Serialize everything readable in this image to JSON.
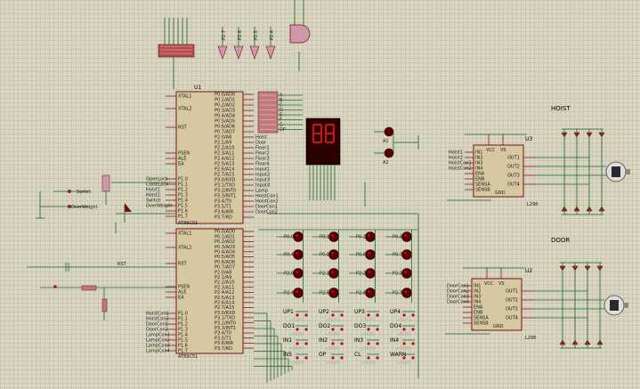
{
  "labels": {
    "u1": "U1",
    "u2": "U2",
    "u3": "U3",
    "hoist": "HOIST",
    "door": "DOOR",
    "mcu_top_part": "AT89C51",
    "mcu_bottom_part": "AT89C51",
    "driver_part": "L298",
    "switch_label": "Switch",
    "overweight_label": "OverWeight",
    "rst_label": "RST",
    "a1": "A1",
    "a2": "A2",
    "bit_label": "BIT",
    "text_placeholder": "<TEXT>"
  },
  "mcu_top_left_pins": [
    "XTAL1",
    "XTAL2",
    "RST",
    "PSEN",
    "ALE",
    "EA",
    "P1.0",
    "P1.1",
    "P1.2",
    "P1.3",
    "P1.4",
    "P1.5",
    "P1.6",
    "P1.7"
  ],
  "mcu_top_right_pins": [
    "P0.0/AD0",
    "P0.1/AD1",
    "P0.2/AD2",
    "P0.3/AD3",
    "P0.4/AD4",
    "P0.5/AD5",
    "P0.6/AD6",
    "P0.7/AD7",
    "P2.0/A8",
    "P2.1/A9",
    "P2.2/A10",
    "P2.3/A11",
    "P2.4/A12",
    "P2.5/A13",
    "P2.6/A14",
    "P2.7/A15",
    "P3.0/RXD",
    "P3.1/TXD",
    "P3.2/INT0",
    "P3.3/INT1",
    "P3.4/T0",
    "P3.5/T1",
    "P3.6/WR",
    "P3.7/RD"
  ],
  "mcu_bottom_left_pins": [
    "XTAL1",
    "XTAL2",
    "RST",
    "PSEN",
    "ALE",
    "EA",
    "P1.0",
    "P1.1",
    "P1.2",
    "P1.3",
    "P1.4",
    "P1.5",
    "P1.6",
    "P1.7"
  ],
  "mcu_bottom_right_pins": [
    "P0.0/AD0",
    "P0.1/AD1",
    "P0.2/AD2",
    "P0.3/AD3",
    "P0.4/AD4",
    "P0.5/AD5",
    "P0.6/AD6",
    "P0.7/AD7",
    "P2.0/A8",
    "P2.1/A9",
    "P2.2/A10",
    "P2.3/A11",
    "P2.4/A12",
    "P2.5/A13",
    "P2.6/A14",
    "P2.7/A15",
    "P3.0/RXD",
    "P3.1/TXD",
    "P3.2/INT0",
    "P3.3/INT1",
    "P3.4/T0",
    "P3.5/T1",
    "P3.6/WR",
    "P3.7/RD"
  ],
  "mcu_top_left_nets": [
    "OpenLock",
    "CloseLock",
    "Hoist1",
    "Hoist2",
    "Switch",
    "OverWeight",
    "",
    ""
  ],
  "mcu_top_right_nets": [
    "Hoist",
    "Door",
    "Floor1",
    "Floor2",
    "Floor3",
    "Floor4",
    "Input1",
    "Input2",
    "Input3",
    "Input4",
    "Lamp",
    "HoistCon1",
    "HoistCon2",
    "DoorCon1",
    "DoorCon2"
  ],
  "mcu_bottom_left_nets": [
    "HoistCon1",
    "HoistCon2",
    "DoorCon1",
    "DoorCon2",
    "LampCon1",
    "LampCon2",
    "LampCon3",
    "LampCon4"
  ],
  "led_matrix": [
    [
      "P0.0",
      "P0.1",
      "P0.2",
      "P0.3"
    ],
    [
      "P0.4",
      "P0.5",
      "P0.6",
      "P0.7"
    ],
    [
      "P2.0",
      "P2.1",
      "P2.2",
      "P2.3"
    ],
    [
      "P2.4",
      "P2.5",
      "P2.6",
      "P2.7"
    ]
  ],
  "buttons": [
    [
      "UP1",
      "UP2",
      "UP3",
      "UP4"
    ],
    [
      "DO1",
      "DO2",
      "DO3",
      "DO4"
    ],
    [
      "IN1",
      "IN2",
      "IN3",
      "IN4"
    ],
    [
      "IN5",
      "OP",
      "CL",
      "WARN"
    ]
  ],
  "driver_left_pins": [
    "IN1",
    "IN2",
    "IN3",
    "IN4",
    "ENA",
    "ENB",
    "SENSA",
    "SENSB"
  ],
  "driver_right_pins": [
    "OUT1",
    "OUT2",
    "OUT3",
    "OUT4"
  ],
  "driver_top_pins": [
    "VCC",
    "VS"
  ],
  "driver_bottom_pin": "GND",
  "hoist_driver_nets": [
    "Hoist1",
    "Hoist2",
    "HoistCon1",
    "HoistCon2"
  ],
  "door_driver_nets": [
    "DoorCon1",
    "DoorCon2",
    "DoorCon3",
    "DoorCon4"
  ],
  "top_gate_nets": [
    "P2.7",
    "P2.6",
    "P2.5",
    "P2.4"
  ],
  "top_gate_label": "OpenLock",
  "port_resistor_labels": [
    "A",
    "B",
    "C",
    "D",
    "E",
    "F",
    "G",
    "DP"
  ]
}
